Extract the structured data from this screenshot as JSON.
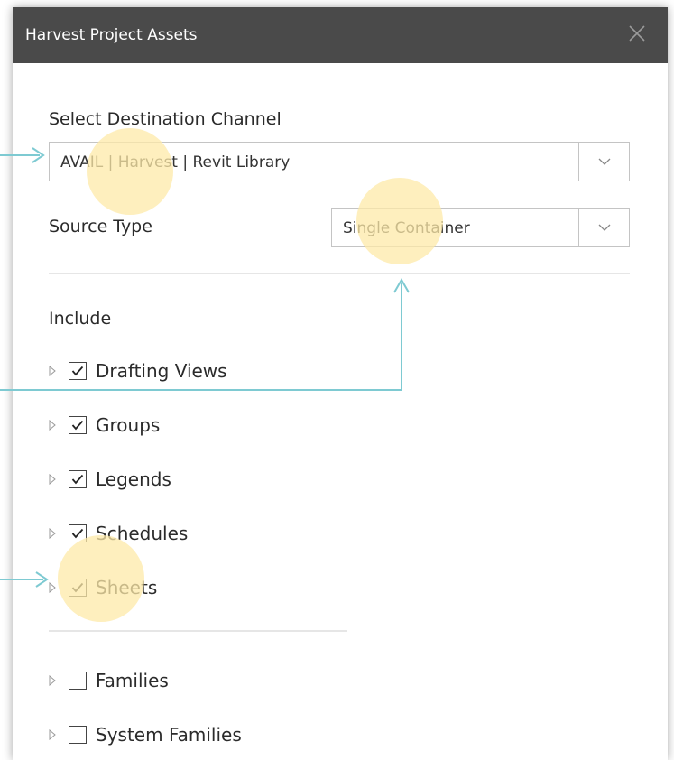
{
  "window": {
    "title": "Harvest Project Assets"
  },
  "destination": {
    "label": "Select Destination Channel",
    "value": "AVAIL | Harvest | Revit Library"
  },
  "source_type": {
    "label": "Source Type",
    "value": "Single Container"
  },
  "include": {
    "label": "Include",
    "items": [
      {
        "label": "Drafting Views",
        "checked": true
      },
      {
        "label": "Groups",
        "checked": true
      },
      {
        "label": "Legends",
        "checked": true
      },
      {
        "label": "Schedules",
        "checked": true
      },
      {
        "label": "Sheets",
        "checked": true
      }
    ],
    "more_items": [
      {
        "label": "Families",
        "checked": false
      },
      {
        "label": "System Families",
        "checked": false
      }
    ]
  },
  "colors": {
    "titlebar": "#4a4a4a",
    "highlight": "#fde9a8",
    "callout": "#7ecad2"
  }
}
